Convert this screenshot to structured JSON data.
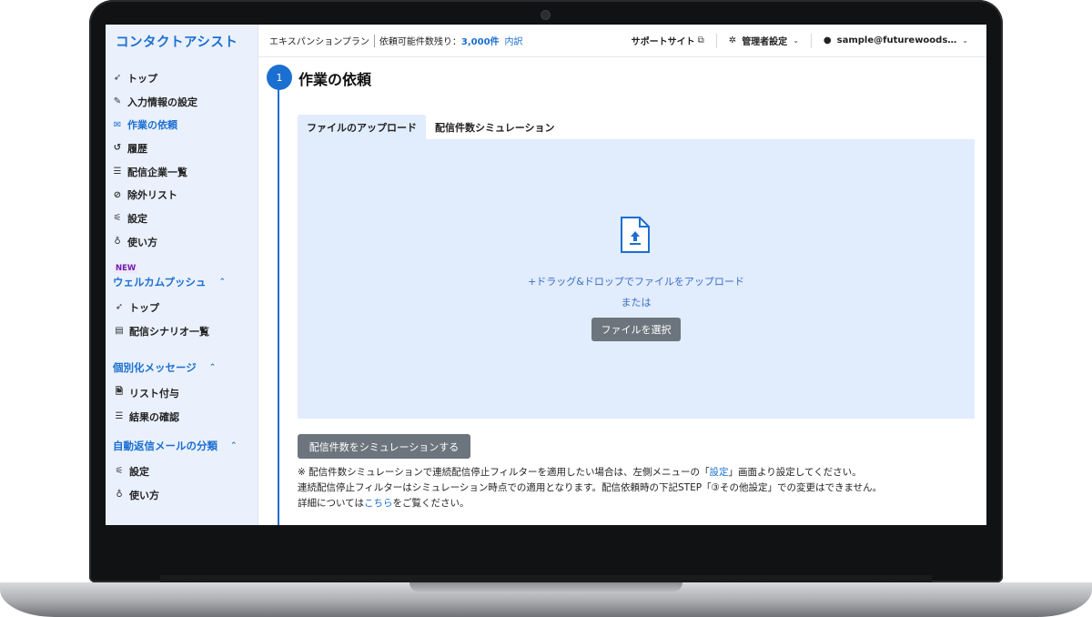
{
  "sidebar": {
    "brand": "コンタクトアシスト",
    "items": [
      {
        "label": "トップ",
        "icon": "paper-plane-icon",
        "glyph": "➶",
        "active": false
      },
      {
        "label": "入力情報の設定",
        "icon": "edit-icon",
        "glyph": "✎",
        "active": false
      },
      {
        "label": "作業の依頼",
        "icon": "envelope-icon",
        "glyph": "✉",
        "active": true
      },
      {
        "label": "履歴",
        "icon": "history-icon",
        "glyph": "↺",
        "active": false
      },
      {
        "label": "配信企業一覧",
        "icon": "list-icon",
        "glyph": "☰",
        "active": false
      },
      {
        "label": "除外リスト",
        "icon": "ban-icon",
        "glyph": "⊘",
        "active": false
      },
      {
        "label": "設定",
        "icon": "sliders-icon",
        "glyph": "⚟",
        "active": false
      },
      {
        "label": "使い方",
        "icon": "lightbulb-icon",
        "glyph": "♁",
        "active": false
      }
    ],
    "new_badge": "NEW",
    "welcome": {
      "title": "ウェルカムプッシュ",
      "items": [
        {
          "label": "トップ",
          "icon": "paper-plane-icon",
          "glyph": "➶"
        },
        {
          "label": "配信シナリオ一覧",
          "icon": "list-alt-icon",
          "glyph": "▤"
        }
      ]
    },
    "personal": {
      "title": "個別化メッセージ",
      "items": [
        {
          "label": "リスト付与",
          "icon": "file-icon",
          "glyph": "🗎"
        },
        {
          "label": "結果の確認",
          "icon": "list-icon",
          "glyph": "☰"
        }
      ]
    },
    "auto_reply": {
      "title": "自動返信メールの分類",
      "items": [
        {
          "label": "設定",
          "icon": "sliders-icon",
          "glyph": "⚟"
        },
        {
          "label": "使い方",
          "icon": "lightbulb-icon",
          "glyph": "♁"
        }
      ]
    }
  },
  "header": {
    "plan": "エキスパンションプラン",
    "remaining_label": "依頼可能件数残り：",
    "remaining_value": "3,000件",
    "detail_link": "内訳",
    "support": "サポートサイト",
    "admin": "管理者設定",
    "user": "sample@futurewoods…"
  },
  "main": {
    "step_number": "1",
    "title": "作業の依頼",
    "tabs": [
      {
        "label": "ファイルのアップロード",
        "active": true
      },
      {
        "label": "配信件数シミュレーション",
        "active": false
      }
    ],
    "dropzone": {
      "drag_text": "+ドラッグ&ドロップでファイルをアップロード",
      "or_text": "または",
      "select_button": "ファイルを選択"
    },
    "simulate_button": "配信件数をシミュレーションする",
    "notes": {
      "line1_pre": "※ 配信件数シミュレーションで連続配信停止フィルターを適用したい場合は、左側メニューの「",
      "line1_link": "設定",
      "line1_post": "」画面より設定してください。",
      "line2": "連続配信停止フィルターはシミュレーション時点での適用となります。配信依頼時の下記STEP「③その他設定」での変更はできません。",
      "line3_pre": "詳細については",
      "line3_link": "こちら",
      "line3_post": "をご覧ください。"
    }
  },
  "colors": {
    "accent": "#1b6fd1",
    "sidebar_bg": "#eaf1fd",
    "dropzone_bg": "#e1ecfd",
    "button_gray": "#6c757d"
  }
}
